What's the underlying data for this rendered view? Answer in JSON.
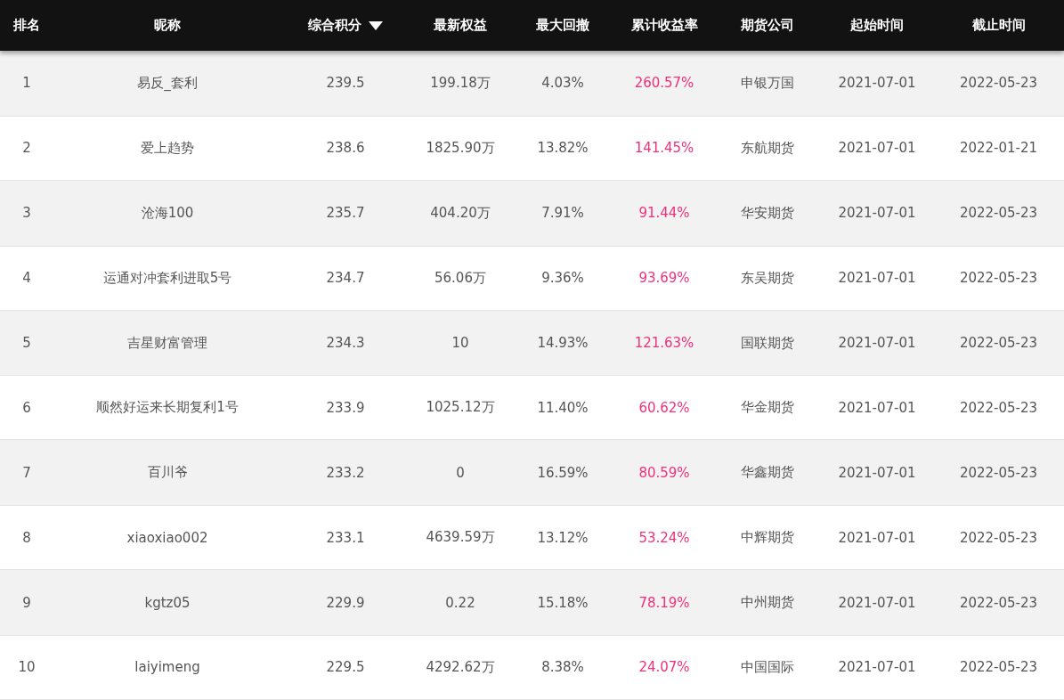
{
  "table": {
    "columns": [
      {
        "label": "排名",
        "sorted": false,
        "accent": false
      },
      {
        "label": "昵称",
        "sorted": false,
        "accent": false
      },
      {
        "label": "综合积分",
        "sorted": true,
        "accent": false
      },
      {
        "label": "最新权益",
        "sorted": false,
        "accent": false
      },
      {
        "label": "最大回撤",
        "sorted": false,
        "accent": false
      },
      {
        "label": "累计收益率",
        "sorted": false,
        "accent": true
      },
      {
        "label": "期货公司",
        "sorted": false,
        "accent": false
      },
      {
        "label": "起始时间",
        "sorted": false,
        "accent": false
      },
      {
        "label": "截止时间",
        "sorted": false,
        "accent": false
      }
    ],
    "rows": [
      [
        "1",
        "易反_套利",
        "239.5",
        "199.18万",
        "4.03%",
        "260.57%",
        "申银万国",
        "2021-07-01",
        "2022-05-23"
      ],
      [
        "2",
        "爱上趋势",
        "238.6",
        "1825.90万",
        "13.82%",
        "141.45%",
        "东航期货",
        "2021-07-01",
        "2022-01-21"
      ],
      [
        "3",
        "沧海100",
        "235.7",
        "404.20万",
        "7.91%",
        "91.44%",
        "华安期货",
        "2021-07-01",
        "2022-05-23"
      ],
      [
        "4",
        "运通对冲套利进取5号",
        "234.7",
        "56.06万",
        "9.36%",
        "93.69%",
        "东吴期货",
        "2021-07-01",
        "2022-05-23"
      ],
      [
        "5",
        "吉星财富管理",
        "234.3",
        "10",
        "14.93%",
        "121.63%",
        "国联期货",
        "2021-07-01",
        "2022-05-23"
      ],
      [
        "6",
        "顺然好运来长期复利1号",
        "233.9",
        "1025.12万",
        "11.40%",
        "60.62%",
        "华金期货",
        "2021-07-01",
        "2022-05-23"
      ],
      [
        "7",
        "百川爷",
        "233.2",
        "0",
        "16.59%",
        "80.59%",
        "华鑫期货",
        "2021-07-01",
        "2022-05-23"
      ],
      [
        "8",
        "xiaoxiao002",
        "233.1",
        "4639.59万",
        "13.12%",
        "53.24%",
        "中辉期货",
        "2021-07-01",
        "2022-05-23"
      ],
      [
        "9",
        "kgtz05",
        "229.9",
        "0.22",
        "15.18%",
        "78.19%",
        "中州期货",
        "2021-07-01",
        "2022-05-23"
      ],
      [
        "10",
        "laiyimeng",
        "229.5",
        "4292.62万",
        "8.38%",
        "24.07%",
        "中国国际",
        "2021-07-01",
        "2022-05-23"
      ]
    ]
  }
}
